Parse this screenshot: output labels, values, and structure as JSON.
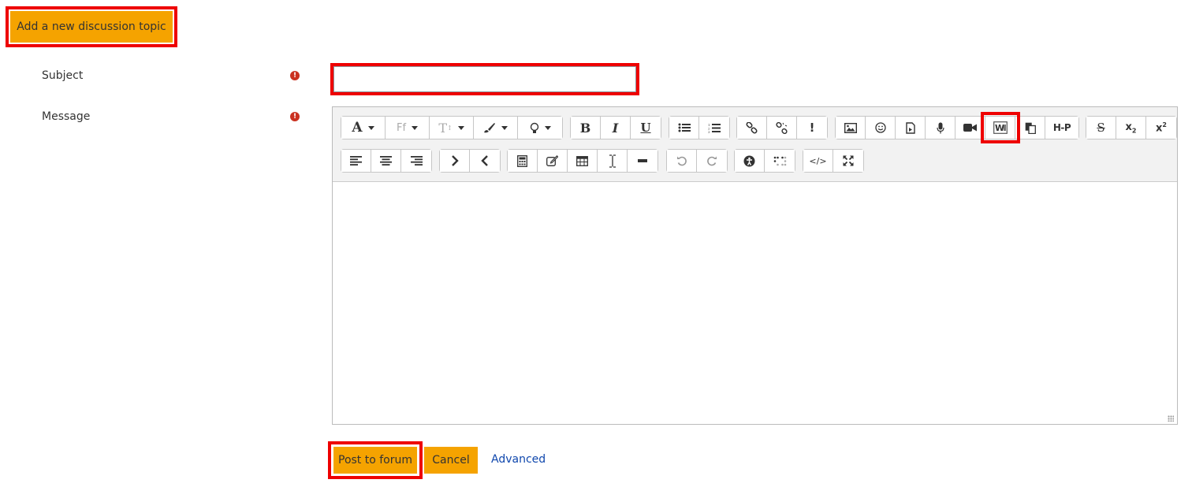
{
  "header": {
    "add_topic_label": "Add a new discussion topic"
  },
  "form": {
    "subject_label": "Subject",
    "message_label": "Message",
    "required_icon": "exclamation-circle-icon",
    "subject_value": ""
  },
  "toolbar": {
    "row1": [
      {
        "id": "font",
        "icon": "font-color-icon",
        "glyph": "A"
      },
      {
        "id": "fontfamily",
        "icon": "font-family-icon",
        "glyph": "Ff"
      },
      {
        "id": "fontsize",
        "icon": "font-size-icon",
        "glyph": "T"
      },
      {
        "id": "brush",
        "icon": "paintbrush-icon"
      },
      {
        "id": "bulb",
        "icon": "lightbulb-icon"
      },
      {
        "id": "bold",
        "icon": "bold-icon",
        "glyph": "B"
      },
      {
        "id": "italic",
        "icon": "italic-icon",
        "glyph": "I"
      },
      {
        "id": "underline",
        "icon": "underline-icon",
        "glyph": "U"
      },
      {
        "id": "ul",
        "icon": "unordered-list-icon"
      },
      {
        "id": "ol",
        "icon": "ordered-list-icon"
      },
      {
        "id": "link",
        "icon": "link-icon"
      },
      {
        "id": "unlink",
        "icon": "unlink-icon"
      },
      {
        "id": "exclaim",
        "icon": "exclamation-icon",
        "glyph": "!"
      },
      {
        "id": "image",
        "icon": "image-icon"
      },
      {
        "id": "emoji",
        "icon": "emoji-icon"
      },
      {
        "id": "media",
        "icon": "media-file-icon"
      },
      {
        "id": "record_audio",
        "icon": "microphone-icon"
      },
      {
        "id": "record_video",
        "icon": "video-camera-icon"
      },
      {
        "id": "wiris",
        "icon": "word-import-icon",
        "glyph": "W"
      },
      {
        "id": "paste",
        "icon": "paste-icon"
      },
      {
        "id": "h5p",
        "icon": "h5p-icon",
        "glyph": "H-P"
      },
      {
        "id": "strike",
        "icon": "strikethrough-icon",
        "glyph": "S"
      },
      {
        "id": "sub",
        "icon": "subscript-icon",
        "glyph": "x₂"
      },
      {
        "id": "sup",
        "icon": "superscript-icon",
        "glyph": "x²"
      }
    ],
    "row2": [
      {
        "id": "align_left",
        "icon": "align-left-icon"
      },
      {
        "id": "align_center",
        "icon": "align-center-icon"
      },
      {
        "id": "align_right",
        "icon": "align-right-icon"
      },
      {
        "id": "indent",
        "icon": "indent-icon"
      },
      {
        "id": "outdent",
        "icon": "outdent-icon"
      },
      {
        "id": "calc",
        "icon": "calculator-icon"
      },
      {
        "id": "edit",
        "icon": "pencil-square-icon"
      },
      {
        "id": "table",
        "icon": "table-icon"
      },
      {
        "id": "cursor",
        "icon": "text-cursor-icon"
      },
      {
        "id": "hr",
        "icon": "horizontal-rule-icon"
      },
      {
        "id": "undo",
        "icon": "undo-icon"
      },
      {
        "id": "redo",
        "icon": "redo-icon"
      },
      {
        "id": "a11y",
        "icon": "accessibility-icon"
      },
      {
        "id": "braille",
        "icon": "braille-icon"
      },
      {
        "id": "html",
        "icon": "code-icon",
        "glyph": "</>"
      },
      {
        "id": "fullscreen",
        "icon": "fullscreen-icon"
      }
    ]
  },
  "actions": {
    "post_label": "Post to forum",
    "cancel_label": "Cancel",
    "advanced_label": "Advanced"
  },
  "colors": {
    "accent": "#f5a300",
    "highlight": "#ee0000",
    "required": "#ca3120",
    "link": "#0f47ad"
  }
}
